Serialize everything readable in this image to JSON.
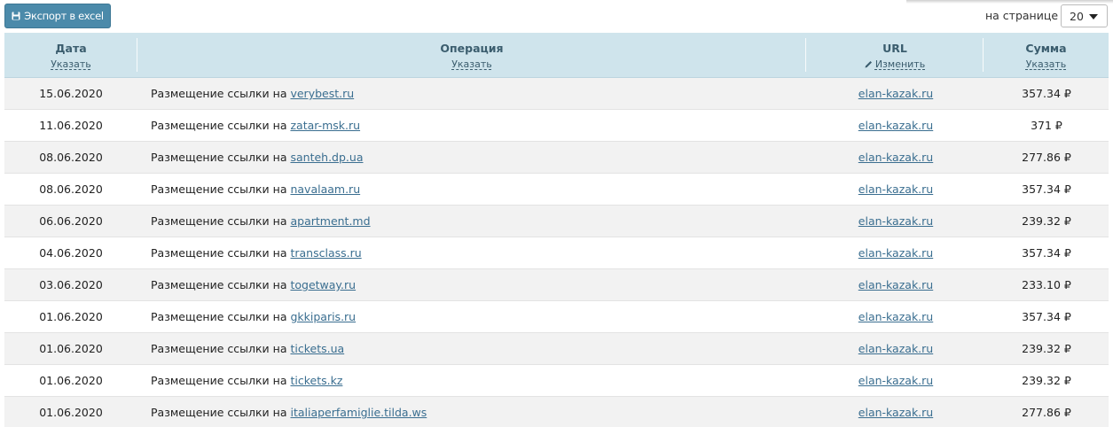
{
  "toolbar": {
    "export_label": "Экспорт в excel",
    "per_page_label": "на странице",
    "per_page_value": "20"
  },
  "table": {
    "columns": [
      {
        "title": "Дата",
        "action": "Указать"
      },
      {
        "title": "Операция",
        "action": "Указать"
      },
      {
        "title": "URL",
        "action": "Изменить"
      },
      {
        "title": "Сумма",
        "action": "Указать"
      }
    ],
    "op_prefix": "Размещение ссылки на",
    "rows": [
      {
        "date": "15.06.2020",
        "site": "verybest.ru",
        "url": "elan-kazak.ru",
        "sum": "357.34 ₽"
      },
      {
        "date": "11.06.2020",
        "site": "zatar-msk.ru",
        "url": "elan-kazak.ru",
        "sum": "371 ₽"
      },
      {
        "date": "08.06.2020",
        "site": "santeh.dp.ua",
        "url": "elan-kazak.ru",
        "sum": "277.86 ₽"
      },
      {
        "date": "08.06.2020",
        "site": "navalaam.ru",
        "url": "elan-kazak.ru",
        "sum": "357.34 ₽"
      },
      {
        "date": "06.06.2020",
        "site": "apartment.md",
        "url": "elan-kazak.ru",
        "sum": "239.32 ₽"
      },
      {
        "date": "04.06.2020",
        "site": "transclass.ru",
        "url": "elan-kazak.ru",
        "sum": "357.34 ₽"
      },
      {
        "date": "03.06.2020",
        "site": "togetway.ru",
        "url": "elan-kazak.ru",
        "sum": "233.10 ₽"
      },
      {
        "date": "01.06.2020",
        "site": "gkkiparis.ru",
        "url": "elan-kazak.ru",
        "sum": "357.34 ₽"
      },
      {
        "date": "01.06.2020",
        "site": "tickets.ua",
        "url": "elan-kazak.ru",
        "sum": "239.32 ₽"
      },
      {
        "date": "01.06.2020",
        "site": "tickets.kz",
        "url": "elan-kazak.ru",
        "sum": "239.32 ₽"
      },
      {
        "date": "01.06.2020",
        "site": "italiaperfamiglie.tilda.ws",
        "url": "elan-kazak.ru",
        "sum": "277.86 ₽"
      }
    ]
  },
  "colors": {
    "header_bg": "#cfe4ec",
    "button_bg": "#4b8aaa",
    "link": "#3a6e90",
    "row_alt": "#f2f2f2"
  }
}
